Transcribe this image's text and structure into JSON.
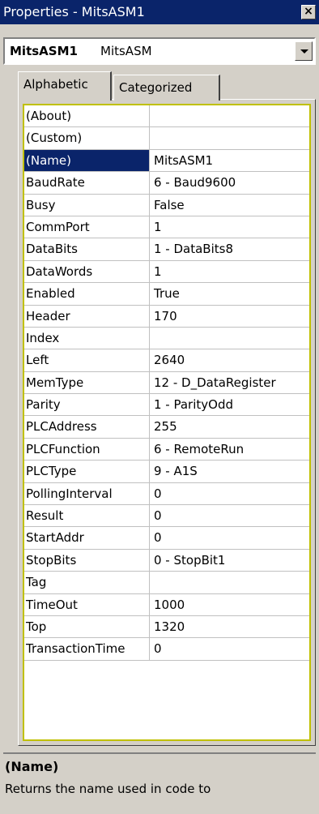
{
  "window": {
    "title": "Properties - MitsASM1",
    "close_glyph": "×"
  },
  "object_selector": {
    "name": "MitsASM1",
    "type": "MitsASM"
  },
  "tabs": [
    {
      "label": "Alphabetic",
      "active": true
    },
    {
      "label": "Categorized",
      "active": false
    }
  ],
  "properties": [
    {
      "name": "(About)",
      "value": ""
    },
    {
      "name": "(Custom)",
      "value": ""
    },
    {
      "name": "(Name)",
      "value": "MitsASM1",
      "selected": true
    },
    {
      "name": "BaudRate",
      "value": "6 - Baud9600"
    },
    {
      "name": "Busy",
      "value": "False"
    },
    {
      "name": "CommPort",
      "value": "1"
    },
    {
      "name": "DataBits",
      "value": "1 - DataBits8"
    },
    {
      "name": "DataWords",
      "value": "1"
    },
    {
      "name": "Enabled",
      "value": "True"
    },
    {
      "name": "Header",
      "value": "170"
    },
    {
      "name": "Index",
      "value": ""
    },
    {
      "name": "Left",
      "value": "2640"
    },
    {
      "name": "MemType",
      "value": "12 - D_DataRegister"
    },
    {
      "name": "Parity",
      "value": "1 - ParityOdd"
    },
    {
      "name": "PLCAddress",
      "value": "255"
    },
    {
      "name": "PLCFunction",
      "value": "6 - RemoteRun"
    },
    {
      "name": "PLCType",
      "value": "9 - A1S"
    },
    {
      "name": "PollingInterval",
      "value": "0"
    },
    {
      "name": "Result",
      "value": "0"
    },
    {
      "name": "StartAddr",
      "value": "0"
    },
    {
      "name": "StopBits",
      "value": "0 - StopBit1"
    },
    {
      "name": "Tag",
      "value": ""
    },
    {
      "name": "TimeOut",
      "value": "1000"
    },
    {
      "name": "Top",
      "value": "1320"
    },
    {
      "name": "TransactionTime",
      "value": "0"
    }
  ],
  "description": {
    "title": "(Name)",
    "text": "Returns the name used in code to"
  },
  "colors": {
    "selection": "#0a246a",
    "title_bar": "#0a246a",
    "face": "#d4d0c8",
    "focus_border": "#c0c000"
  }
}
